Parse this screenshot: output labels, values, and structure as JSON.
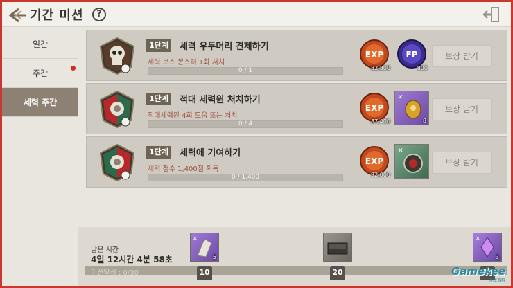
{
  "header": {
    "title": "기간 미션",
    "help_glyph": "?"
  },
  "sidebar": {
    "tabs": [
      {
        "label": "일간",
        "active": false,
        "badge": false
      },
      {
        "label": "주간",
        "active": false,
        "badge": true
      },
      {
        "label": "세력 주간",
        "active": true,
        "badge": false
      }
    ]
  },
  "missions": [
    {
      "stage": "1단계",
      "name": "세력 우두머리 견제하기",
      "desc": "세력 보스 몬스터 1회 처치",
      "progress_text": "0 / 1",
      "progress": 0,
      "rewards": [
        {
          "kind": "exp",
          "label": "EXP",
          "amount": "82,800"
        },
        {
          "kind": "fp",
          "label": "FP",
          "amount": "800"
        }
      ],
      "claim_label": "보상 받기"
    },
    {
      "stage": "1단계",
      "name": "적대 세력원 처치하기",
      "desc": "적대세력원 4회 도움 또는 처치",
      "progress_text": "0 / 4",
      "progress": 0,
      "rewards": [
        {
          "kind": "exp",
          "label": "EXP",
          "amount": "87,400"
        },
        {
          "kind": "item-gold",
          "label": "",
          "amount": "8"
        }
      ],
      "claim_label": "보상 받기"
    },
    {
      "stage": "1단계",
      "name": "세력에 기여하기",
      "desc": "세력 점수 1,400점 획득",
      "progress_text": "0 / 1,400",
      "progress": 0,
      "rewards": [
        {
          "kind": "exp",
          "label": "EXP",
          "amount": "92,000"
        },
        {
          "kind": "item-compass",
          "label": "",
          "amount": ""
        }
      ],
      "claim_label": "보상 받기"
    }
  ],
  "bottom": {
    "remain_label": "남은 시간",
    "remain_time": "4일 12시간 4분 58초",
    "achieved_text": "미션달성 : 0/30",
    "achieved_progress": 0,
    "milestones": [
      {
        "tag": "10",
        "amount": "5",
        "kind": "scroll-purple"
      },
      {
        "tag": "20",
        "amount": "",
        "kind": "chest-gray"
      },
      {
        "tag": "30",
        "amount": "3",
        "kind": "crystal-purple"
      }
    ]
  },
  "watermark": {
    "text": "Gamekee",
    "sub": "游戏百科"
  },
  "colors": {
    "frame": "#c9372f",
    "accent_red": "#d02a22",
    "active_tab": "#8c8172",
    "desc_text": "#a0523e"
  }
}
